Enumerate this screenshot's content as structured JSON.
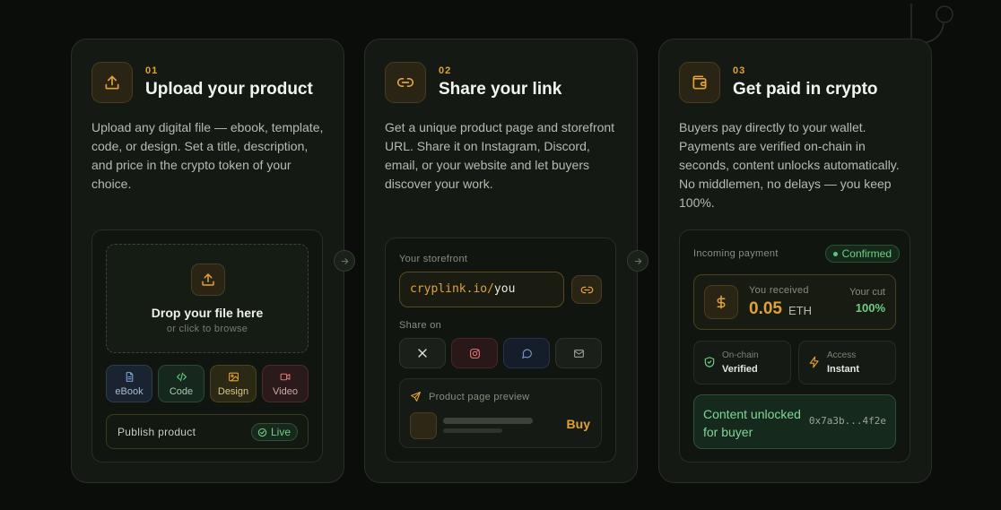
{
  "steps": [
    {
      "number": "01",
      "title": "Upload your product",
      "description": "Upload any digital file — ebook, template, code, or design. Set a title, description, and price in the crypto token of your choice.",
      "icon": "upload-icon",
      "dropzone": {
        "title": "Drop your file here",
        "subtitle": "or click to browse"
      },
      "file_types": [
        {
          "label": "eBook",
          "icon": "document-icon",
          "color": "#7aa2d6"
        },
        {
          "label": "Code",
          "icon": "code-icon",
          "color": "#6fcf86"
        },
        {
          "label": "Design",
          "icon": "image-icon",
          "color": "#e3a236"
        },
        {
          "label": "Video",
          "icon": "video-icon",
          "color": "#e07070"
        }
      ],
      "publish": {
        "label": "Publish product",
        "status": "Live"
      }
    },
    {
      "number": "02",
      "title": "Share your link",
      "description": "Get a unique product page and storefront URL. Share it on Instagram, Discord, email, or your website and let buyers discover your work.",
      "icon": "link-icon",
      "storefront_label": "Your storefront",
      "url_domain": "cryplink.io/",
      "url_user": "you",
      "share_label": "Share on",
      "share_targets": [
        "x-icon",
        "instagram-icon",
        "discord-icon",
        "email-icon"
      ],
      "preview": {
        "label": "Product page preview",
        "buy_label": "Buy"
      }
    },
    {
      "number": "03",
      "title": "Get paid in crypto",
      "description": "Buyers pay directly to your wallet. Payments are verified on-chain in seconds, content unlocks automatically. No middlemen, no delays — you keep 100%.",
      "icon": "wallet-icon",
      "incoming_label": "Incoming payment",
      "status": "Confirmed",
      "received_label": "You received",
      "received_amount": "0.05",
      "received_unit": "ETH",
      "cut_label": "Your cut",
      "cut_value": "100%",
      "onchain": {
        "label": "On-chain",
        "value": "Verified"
      },
      "access": {
        "label": "Access",
        "value": "Instant"
      },
      "unlocked_text": "Content unlocked for buyer",
      "tx_hash": "0x7a3b...4f2e"
    }
  ],
  "colors": {
    "accent": "#e3a236",
    "success": "#6fcf86",
    "background": "#0a0d0a",
    "card": "#141a13"
  }
}
